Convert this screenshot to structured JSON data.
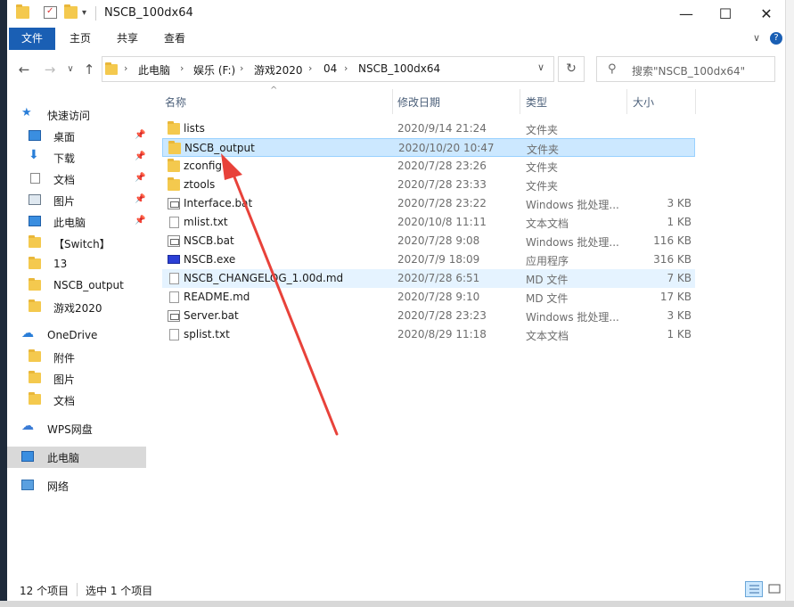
{
  "window": {
    "title": "NSCB_100dx64",
    "minimize": "—",
    "maximize": "☐",
    "close": "✕"
  },
  "ribbon": {
    "tabs": [
      "文件",
      "主页",
      "共享",
      "查看"
    ]
  },
  "address": {
    "crumbs": [
      "此电脑",
      "娱乐 (F:)",
      "游戏2020",
      "04",
      "NSCB_100dx64"
    ],
    "search_placeholder": "搜索\"NSCB_100dx64\""
  },
  "columns": {
    "name": "名称",
    "date": "修改日期",
    "type": "类型",
    "size": "大小"
  },
  "sidebar": {
    "quick_access": "快速访问",
    "items": [
      {
        "label": "桌面",
        "icon": "desktop-icon"
      },
      {
        "label": "下载",
        "icon": "download-icon"
      },
      {
        "label": "文档",
        "icon": "documents-icon"
      },
      {
        "label": "图片",
        "icon": "pictures-icon"
      },
      {
        "label": "此电脑",
        "icon": "computer-icon"
      },
      {
        "label": "【Switch】",
        "icon": "folder-icon"
      },
      {
        "label": "13",
        "icon": "folder-icon"
      },
      {
        "label": "NSCB_output",
        "icon": "folder-icon"
      },
      {
        "label": "游戏2020",
        "icon": "folder-icon"
      }
    ],
    "onedrive": "OneDrive",
    "onedrive_items": [
      "附件",
      "图片",
      "文档"
    ],
    "wps": "WPS网盘",
    "this_pc": "此电脑",
    "network": "网络"
  },
  "files": [
    {
      "name": "lists",
      "date": "2020/9/14 21:24",
      "type": "文件夹",
      "size": "",
      "icon": "folder-icon"
    },
    {
      "name": "NSCB_output",
      "date": "2020/10/20 10:47",
      "type": "文件夹",
      "size": "",
      "icon": "folder-icon"
    },
    {
      "name": "zconfig",
      "date": "2020/7/28 23:26",
      "type": "文件夹",
      "size": "",
      "icon": "folder-icon"
    },
    {
      "name": "ztools",
      "date": "2020/7/28 23:33",
      "type": "文件夹",
      "size": "",
      "icon": "folder-icon"
    },
    {
      "name": "Interface.bat",
      "date": "2020/7/28 23:22",
      "type": "Windows 批处理...",
      "size": "3 KB",
      "icon": "batch-file-icon"
    },
    {
      "name": "mlist.txt",
      "date": "2020/10/8 11:11",
      "type": "文本文档",
      "size": "1 KB",
      "icon": "text-file-icon"
    },
    {
      "name": "NSCB.bat",
      "date": "2020/7/28 9:08",
      "type": "Windows 批处理...",
      "size": "116 KB",
      "icon": "batch-file-icon"
    },
    {
      "name": "NSCB.exe",
      "date": "2020/7/9 18:09",
      "type": "应用程序",
      "size": "316 KB",
      "icon": "exe-icon"
    },
    {
      "name": "NSCB_CHANGELOG_1.00d.md",
      "date": "2020/7/28 6:51",
      "type": "MD 文件",
      "size": "7 KB",
      "icon": "md-file-icon"
    },
    {
      "name": "README.md",
      "date": "2020/7/28 9:10",
      "type": "MD 文件",
      "size": "17 KB",
      "icon": "md-file-icon"
    },
    {
      "name": "Server.bat",
      "date": "2020/7/28 23:23",
      "type": "Windows 批处理...",
      "size": "3 KB",
      "icon": "batch-file-icon"
    },
    {
      "name": "splist.txt",
      "date": "2020/8/29 11:18",
      "type": "文本文档",
      "size": "1 KB",
      "icon": "text-file-icon"
    }
  ],
  "status": {
    "count": "12 个项目",
    "selected": "选中 1 个项目"
  },
  "colors": {
    "accent": "#1a5fb4",
    "selection": "#cce8ff",
    "annotation_arrow": "#e8423a"
  }
}
